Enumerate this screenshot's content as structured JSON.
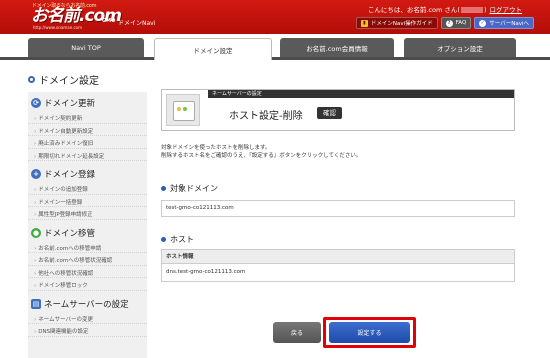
{
  "header": {
    "logo_tagline": "ドメイン取るならお名前.com",
    "logo_text": "お名前.com",
    "logo_url": "http://www.onamae.com",
    "logo_gmo": "GMO",
    "site_name": "ドメインNavi",
    "greeting_prefix": "こんにちは、お名前.com さん(",
    "greeting_suffix": ")",
    "logout_label": "ログアウト",
    "btn_guide": "ドメインNavi操作ガイド",
    "btn_faq": "FAQ",
    "btn_server": "サーバーNaviへ",
    "colors": {
      "header_red": "#c8140e",
      "server_blue": "#4a68c6"
    }
  },
  "tabs": [
    {
      "label": "Navi TOP",
      "active": false
    },
    {
      "label": "ドメイン設定",
      "active": true
    },
    {
      "label": "お名前.com会員情報",
      "active": false
    },
    {
      "label": "オプション設定",
      "active": false
    }
  ],
  "page_title": "ドメイン設定",
  "sidebar": {
    "groups": [
      {
        "title": "ドメイン更新",
        "icon": "refresh-icon",
        "color": "#3f6fbd",
        "items": [
          "ドメイン契約更新",
          "ドメイン自動更新設定",
          "廃止済みドメイン復旧",
          "期限切れドメイン延長設定"
        ]
      },
      {
        "title": "ドメイン登録",
        "icon": "plus-icon",
        "color": "#3f6fbd",
        "items": [
          "ドメインの追加登録",
          "ドメイン一括登録",
          "属性型JP登録申請修正"
        ]
      },
      {
        "title": "ドメイン移管",
        "icon": "globe-icon",
        "color": "#3cae3c",
        "items": [
          "お名前.comへの移管申請",
          "お名前.comへの移管状況確認",
          "他社への移管状況確認",
          "ドメイン移管ロック"
        ]
      },
      {
        "title": "ネームサーバーの設定",
        "icon": "server-icon",
        "color": "#3f6fbd",
        "items": [
          "ネームサーバーの変更",
          "DNS関連機能の設定"
        ]
      }
    ]
  },
  "main": {
    "strip_label": "ネームサーバーの設定",
    "title": "ホスト設定-削除",
    "badge": "確認",
    "desc_line1": "対象ドメインを使ったホストを削除します。",
    "desc_line2": "削除するホスト名をご確認のうえ、『設定する』ボタンをクリックしてください。",
    "section_domain": "対象ドメイン",
    "domain_value": "test-gmo-co121113.com",
    "section_host": "ホスト",
    "host_header": "ホスト情報",
    "host_value": "dns.test-gmo-co121113.com",
    "back_label": "戻る",
    "submit_label": "設定する"
  }
}
